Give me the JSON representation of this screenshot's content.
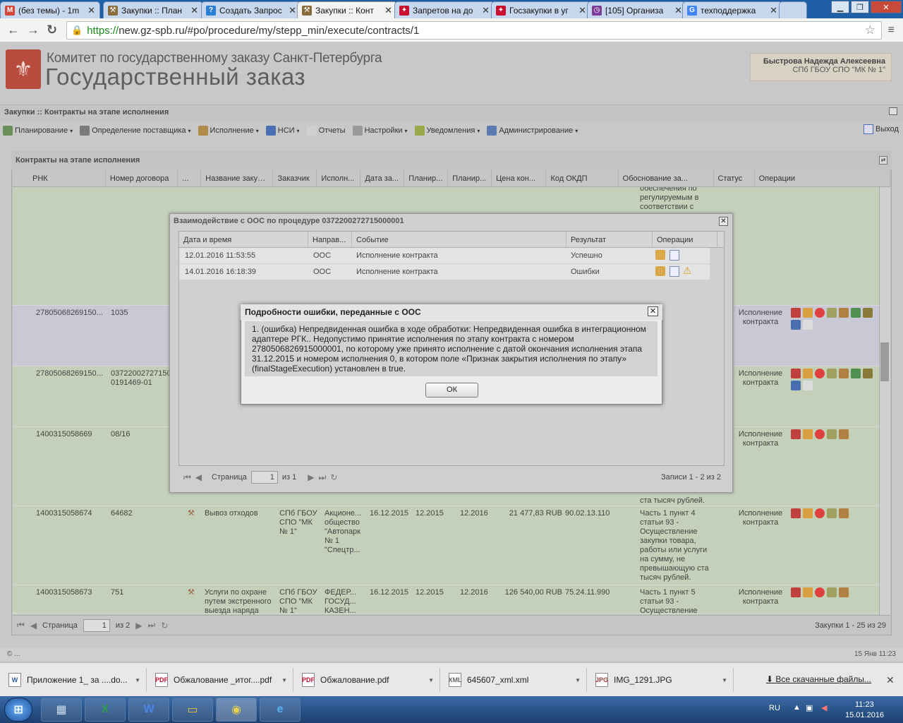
{
  "browser": {
    "tabs": [
      {
        "label": "(без темы) - 1m",
        "fav": "M",
        "favcolor": "#d44638"
      },
      {
        "label": "Закупки :: План",
        "fav": "⚒",
        "favcolor": "#8a6d3b"
      },
      {
        "label": "Создать Запрос",
        "fav": "?",
        "favcolor": "#2a7fd4"
      },
      {
        "label": "Закупки :: Конт",
        "fav": "⚒",
        "favcolor": "#8a6d3b"
      },
      {
        "label": "Запретов на до",
        "fav": "✦",
        "favcolor": "#c8102e"
      },
      {
        "label": "Госзакупки в уг",
        "fav": "✦",
        "favcolor": "#c8102e"
      },
      {
        "label": "[105] Организа",
        "fav": "◷",
        "favcolor": "#7d3c98"
      },
      {
        "label": "техподдержка",
        "fav": "G",
        "favcolor": "#4285f4"
      }
    ],
    "url_scheme": "https://",
    "url_rest": "new.gz-spb.ru/#po/procedure/my/stepp_min/execute/contracts/1"
  },
  "header": {
    "org_line1": "Комитет по государственному заказу Санкт-Петербурга",
    "org_line2": "Государственный заказ",
    "user_name": "Быстрова Надежда Алексеевна",
    "user_org": "СПб ГБОУ СПО \"МК № 1\""
  },
  "breadcrumb": "Закупки :: Контракты на этапе исполнения",
  "menu": [
    {
      "label": "Планирование",
      "icon": "#6a8f5a",
      "dd": true
    },
    {
      "label": "Определение поставщика",
      "icon": "#7a7a7a",
      "dd": true
    },
    {
      "label": "Исполнение",
      "icon": "#b08a4a",
      "dd": true
    },
    {
      "label": "НСИ",
      "icon": "#4a6fb0",
      "dd": true
    },
    {
      "label": "Отчеты",
      "icon": "#d0d0d0",
      "dd": false
    },
    {
      "label": "Настройки",
      "icon": "#9a9a9a",
      "dd": true
    },
    {
      "label": "Уведомления",
      "icon": "#9aa84a",
      "dd": true
    },
    {
      "label": "Администрирование",
      "icon": "#5a7ab0",
      "dd": true
    }
  ],
  "exit_label": "Выход",
  "panel_title": "Контракты на этапе исполнения",
  "grid": {
    "columns": [
      "РНК",
      "Номер договора",
      "...",
      "Название закупки",
      "Заказчик",
      "Исполн...",
      "Дата за...",
      "Планир...",
      "Планир...",
      "Цена кон...",
      "Код ОКДП",
      "Обоснование за...",
      "Статус",
      "Операции"
    ],
    "rows": [
      {
        "rnk": "",
        "num": "",
        "name": "",
        "cust": "",
        "exec": "",
        "date": "",
        "p1": "",
        "p2": "",
        "price": "",
        "okdp": "",
        "basis": "обеспечения по регулируемым в соответствии с",
        "status": "",
        "ops": 0,
        "h": 168
      },
      {
        "rnk": "27805068269150...",
        "num": "1035",
        "name": "",
        "cust": "",
        "exec": "",
        "date": "",
        "p1": "",
        "p2": "",
        "price": "",
        "okdp": "",
        "basis": "",
        "status": "Исполнение контракта",
        "ops": 9,
        "h": 86,
        "sel": true
      },
      {
        "rnk": "27805068269150...",
        "num": "03722002727150 0191469-01",
        "name": "",
        "cust": "",
        "exec": "",
        "date": "",
        "p1": "",
        "p2": "",
        "price": "",
        "okdp": "",
        "basis": "",
        "status": "Исполнение контракта",
        "ops": 9,
        "h": 86
      },
      {
        "rnk": "1400315058669",
        "num": "08/16",
        "name": "",
        "cust": "",
        "exec": "",
        "date": "",
        "p1": "",
        "p2": "",
        "price": "",
        "okdp": "",
        "basis": "ста тысяч рублей.",
        "status": "Исполнение контракта",
        "ops": 5,
        "h": 112
      },
      {
        "rnk": "1400315058674",
        "num": "64682",
        "name": "Вывоз отходов",
        "cust": "СПб ГБОУ СПО \"МК № 1\"",
        "exec": "Акционе... общество \"Автопарк № 1 \"Спецтр...",
        "date": "16.12.2015",
        "p1": "12.2015",
        "p2": "12.2016",
        "price": "21 477,83 RUB",
        "okdp": "90.02.13.110",
        "basis": "Часть 1 пункт 4 статьи 93 - Осуществление закупки товара, работы или услуги на сумму, не превышающую ста тысяч рублей.",
        "status": "Исполнение контракта",
        "ops": 5,
        "h": 112
      },
      {
        "rnk": "1400315058673",
        "num": "751",
        "name": "Услуги по охране путем экстренного выезда наряда",
        "cust": "СПб ГБОУ СПО \"МК № 1\"",
        "exec": "ФЕДЕР... ГОСУД... КАЗЕН...",
        "date": "16.12.2015",
        "p1": "12.2015",
        "p2": "12.2016",
        "price": "126 540,00 RUB",
        "okdp": "75.24.11.990",
        "basis": "Часть 1 пункт 5 статьи 93 - Осуществление",
        "status": "Исполнение контракта",
        "ops": 5,
        "h": 40
      }
    ],
    "pager": {
      "page_label": "Страница",
      "page": "1",
      "of": "из 2",
      "summary": "Закупки 1 - 25 из 29"
    }
  },
  "ooc_dialog": {
    "title": "Взаимодействие с ООС по процедуре 0372200272715000001",
    "columns": [
      "Дата и время",
      "Направ...",
      "Событие",
      "Результат",
      "Операции"
    ],
    "rows": [
      {
        "dt": "12.01.2016 11:53:55",
        "dir": "ООС",
        "event": "Исполнение контракта",
        "result": "Успешно",
        "warn": false
      },
      {
        "dt": "14.01.2016 16:18:39",
        "dir": "ООС",
        "event": "Исполнение контракта",
        "result": "Ошибки",
        "warn": true
      }
    ],
    "pager": {
      "page_label": "Страница",
      "page": "1",
      "of": "из 1",
      "summary": "Записи 1 - 2 из 2"
    }
  },
  "error_dialog": {
    "title": "Подробности ошибки, переданные с ООС",
    "message": "1. (ошибка) Непредвиденная ошибка в ходе обработки: Непредвиденная ошибка в интеграционном адаптере РГК.. Недопустимо принятие исполнения по этапу контракта с номером 2780506826915000001, по которому уже принято исполнение с датой окончания исполнения этапа 31.12.2015 и номером исполнения 0, в котором поле «Признак закрытия исполнения по этапу» (finalStageExecution) установлен в true.",
    "ok_label": "ОК"
  },
  "status_left": "© ...",
  "status_time": "15 Янв 11:23",
  "downloads": [
    {
      "name": "Приложение 1_ за ....do...",
      "type": "W",
      "color": "#2b579a"
    },
    {
      "name": "Обжалование _итог....pdf",
      "type": "PDF",
      "color": "#c8102e"
    },
    {
      "name": "Обжалование.pdf",
      "type": "PDF",
      "color": "#c8102e"
    },
    {
      "name": "645607_xml.xml",
      "type": "XML",
      "color": "#666"
    },
    {
      "name": "IMG_1291.JPG",
      "type": "JPG",
      "color": "#a04040"
    }
  ],
  "downloads_all": "Все скачанные файлы...",
  "taskbar": {
    "lang": "RU",
    "time": "11:23",
    "date": "15.01.2016"
  }
}
